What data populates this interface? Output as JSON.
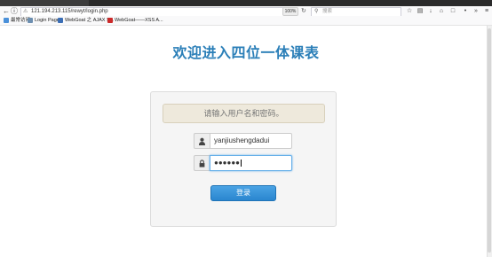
{
  "browser": {
    "url": "121.194.213.115/rewyt/login.php",
    "zoom": "100%",
    "search_placeholder": "搜索"
  },
  "bookmarks": [
    {
      "label": "最常访问",
      "color": "#4a90d9"
    },
    {
      "label": "Login Page",
      "color": "#6d8fb0"
    },
    {
      "label": "WebGoat 之 AJAX S...",
      "color": "#3b6eb5"
    },
    {
      "label": "WebGoat——XSS A...",
      "color": "#cc2a2a"
    }
  ],
  "page": {
    "title": "欢迎进入四位一体课表"
  },
  "login": {
    "prompt": "请输入用户名和密码。",
    "username_value": "yanjiushengdadui",
    "password_mask": "●●●●●●",
    "submit_label": "登录"
  }
}
